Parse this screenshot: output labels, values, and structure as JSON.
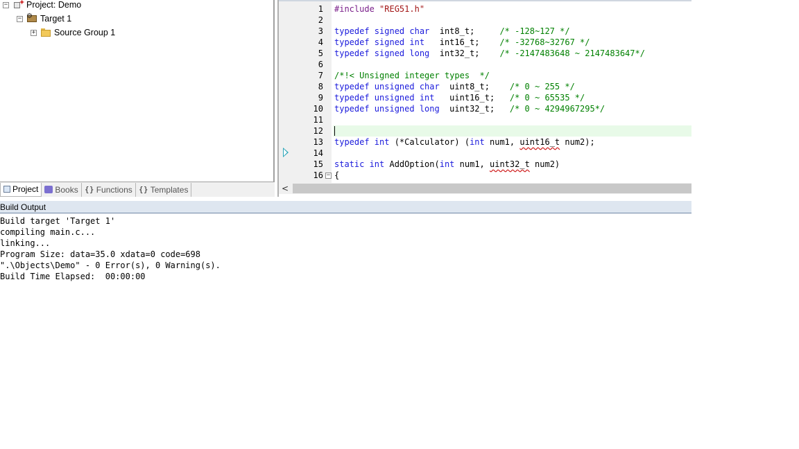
{
  "project_tree": {
    "project_label": "Project: Demo",
    "target_label": "Target 1",
    "group_label": "Source Group 1",
    "toggle_expanded": "−",
    "toggle_collapsed": "+"
  },
  "panel_tabs": {
    "project": "Project",
    "books": "Books",
    "functions_glyph": "{}",
    "functions": "Functions",
    "templates_glyph": "{}",
    "templates": "Templates"
  },
  "editor": {
    "current_line": 12,
    "line_numbers": [
      "1",
      "2",
      "3",
      "4",
      "5",
      "6",
      "7",
      "8",
      "9",
      "10",
      "11",
      "12",
      "13",
      "14",
      "15",
      "16"
    ],
    "fold_glyph": "−",
    "code_lines": [
      [
        {
          "t": "#include ",
          "c": "pp"
        },
        {
          "t": "\"REG51.h\"",
          "c": "str"
        }
      ],
      [],
      [
        {
          "t": "typedef signed char",
          "c": "kw"
        },
        {
          "t": "  int8_t;     "
        },
        {
          "t": "/* -128~127 */",
          "c": "cm"
        }
      ],
      [
        {
          "t": "typedef signed int",
          "c": "kw"
        },
        {
          "t": "   int16_t;    "
        },
        {
          "t": "/* -32768~32767 */",
          "c": "cm"
        }
      ],
      [
        {
          "t": "typedef signed long",
          "c": "kw"
        },
        {
          "t": "  int32_t;    "
        },
        {
          "t": "/* -2147483648 ~ 2147483647*/",
          "c": "cm"
        }
      ],
      [],
      [
        {
          "t": "/*!< Unsigned integer types  */",
          "c": "cm"
        }
      ],
      [
        {
          "t": "typedef unsigned char",
          "c": "kw"
        },
        {
          "t": "  uint8_t;    "
        },
        {
          "t": "/* 0 ~ 255 */",
          "c": "cm"
        }
      ],
      [
        {
          "t": "typedef unsigned int",
          "c": "kw"
        },
        {
          "t": "   uint16_t;   "
        },
        {
          "t": "/* 0 ~ 65535 */",
          "c": "cm"
        }
      ],
      [
        {
          "t": "typedef unsigned long",
          "c": "kw"
        },
        {
          "t": "  uint32_t;   "
        },
        {
          "t": "/* 0 ~ 4294967295*/",
          "c": "cm"
        }
      ],
      [],
      [],
      [
        {
          "t": "typedef int",
          "c": "kw"
        },
        {
          "t": " (*Calculator) ("
        },
        {
          "t": "int",
          "c": "kw"
        },
        {
          "t": " num1, "
        },
        {
          "t": "uint16_t",
          "c": "squig"
        },
        {
          "t": " num2);"
        }
      ],
      [],
      [
        {
          "t": "static int",
          "c": "kw"
        },
        {
          "t": " AddOption("
        },
        {
          "t": "int",
          "c": "kw"
        },
        {
          "t": " num1, "
        },
        {
          "t": "uint32_t",
          "c": "squig"
        },
        {
          "t": " num2)"
        }
      ],
      [
        {
          "t": "{"
        }
      ]
    ]
  },
  "scrollbar": {
    "left_arrow": "<"
  },
  "build_output": {
    "title": "Build Output",
    "lines": [
      "Build target 'Target 1'",
      "compiling main.c...",
      "linking...",
      "Program Size: data=35.0 xdata=0 code=698",
      "\".\\Objects\\Demo\" - 0 Error(s), 0 Warning(s).",
      "Build Time Elapsed:  00:00:00"
    ]
  }
}
